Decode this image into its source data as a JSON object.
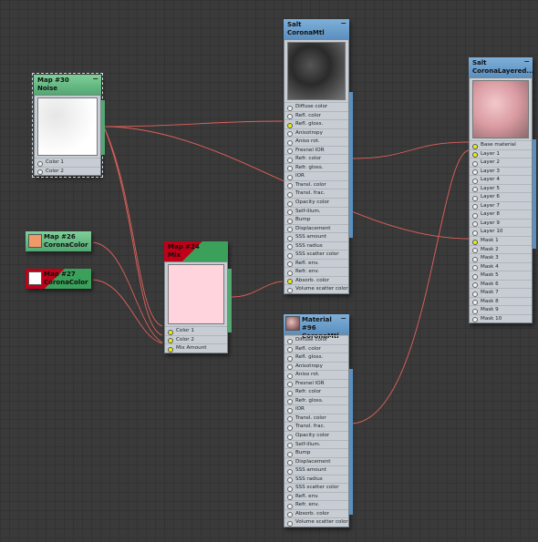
{
  "nodes": {
    "salt_top": {
      "title": "Salt",
      "subtitle": "CoronaMtl",
      "min": "−"
    },
    "salt_layered": {
      "title": "Salt",
      "subtitle": "CoronaLayered...",
      "min": "−"
    },
    "map30": {
      "title": "Map #30",
      "subtitle": "Noise",
      "min": "−"
    },
    "map26": {
      "title": "Map #26",
      "subtitle": "CoronaColor"
    },
    "map27": {
      "title": "Map #27",
      "subtitle": "CoronaColor"
    },
    "map24": {
      "title": "Map #24",
      "subtitle": "Mix"
    },
    "mat96": {
      "title": "Material #96",
      "subtitle": "CoronaMtl",
      "min": "−"
    }
  },
  "corona_mtl_sockets": [
    "Diffuse color",
    "Refl. color",
    "Refl. gloss.",
    "Anisotropy",
    "Aniso rot.",
    "Fresnel IOR",
    "Refr. color",
    "Refr. gloss.",
    "IOR",
    "Transl. color",
    "Transl. frac.",
    "Opacity color",
    "Self-illum.",
    "Bump",
    "Displacement",
    "SSS amount",
    "SSS radius",
    "SSS scatter color",
    "Refl. env.",
    "Refr. env.",
    "Absorb. color",
    "Volume scatter color"
  ],
  "layered_sockets": [
    "Base material",
    "Layer 1",
    "Layer 2",
    "Layer 3",
    "Layer 4",
    "Layer 5",
    "Layer 6",
    "Layer 7",
    "Layer 8",
    "Layer 9",
    "Layer 10",
    "Mask 1",
    "Mask 2",
    "Mask 3",
    "Mask 4",
    "Mask 5",
    "Mask 6",
    "Mask 7",
    "Mask 8",
    "Mask 9",
    "Mask 10"
  ],
  "noise_sockets": [
    "Color 1",
    "Color 2"
  ],
  "mix_sockets": [
    "Color 1",
    "Color 2",
    "Mix Amount"
  ],
  "colors": {
    "accent_wire": "#e0605a",
    "socket_active": "#e8f000",
    "map26_swatch": "#f09a6a",
    "map27_swatch": "#ffffff",
    "mix_preview": "#ffd4dc"
  }
}
